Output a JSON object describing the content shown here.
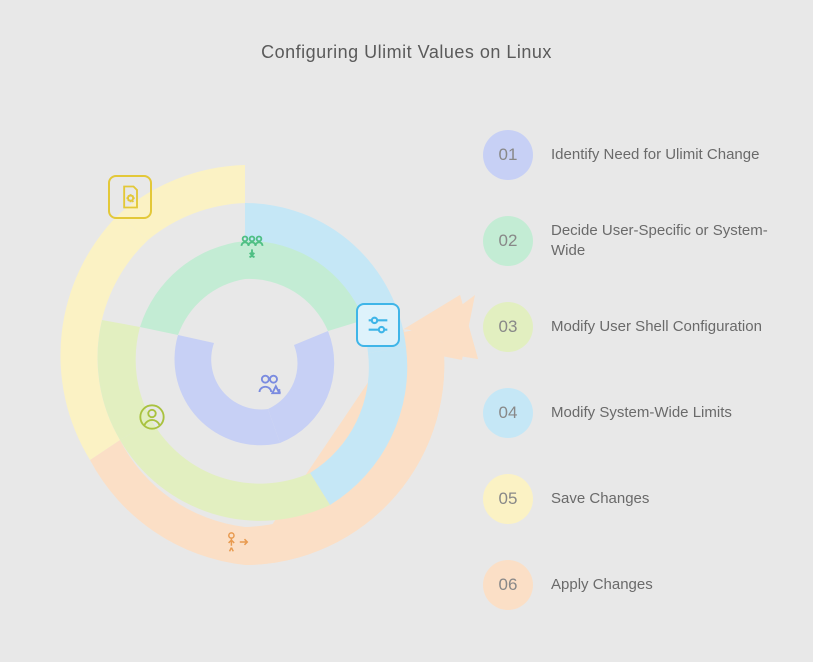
{
  "title": "Configuring Ulimit Values on Linux",
  "steps": [
    {
      "num": "01",
      "label": "Identify Need for Ulimit Change",
      "color": "#c7d0f5",
      "icon": "users-warning-icon"
    },
    {
      "num": "02",
      "label": "Decide User-Specific or System-Wide",
      "color": "#c3ecd4",
      "icon": "group-select-icon"
    },
    {
      "num": "03",
      "label": "Modify User Shell Configuration",
      "color": "#e2efc0",
      "icon": "user-icon"
    },
    {
      "num": "04",
      "label": "Modify System-Wide Limits",
      "color": "#c5e7f6",
      "icon": "sliders-icon"
    },
    {
      "num": "05",
      "label": "Save Changes",
      "color": "#fbf2c4",
      "icon": "file-gear-icon"
    },
    {
      "num": "06",
      "label": "Apply Changes",
      "color": "#fbdfc6",
      "icon": "person-arrow-icon"
    }
  ]
}
